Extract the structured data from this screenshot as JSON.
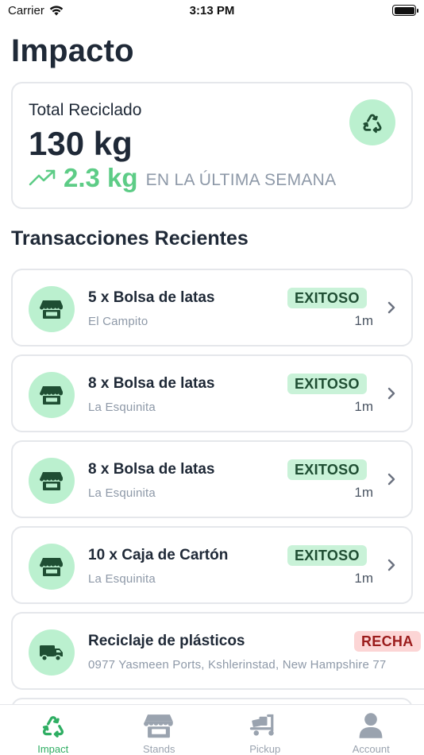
{
  "status_bar": {
    "carrier": "Carrier",
    "time": "3:13 PM"
  },
  "page": {
    "title": "Impacto"
  },
  "summary": {
    "label": "Total Reciclado",
    "value": "130 kg",
    "trend_value": "2.3 kg",
    "trend_caption": "EN LA ÚLTIMA SEMANA",
    "icon": "recycle-icon"
  },
  "recent": {
    "title": "Transacciones Recientes",
    "items": [
      {
        "title": "5 x Bolsa de latas",
        "subtitle": "El Campito",
        "status": "EXITOSO",
        "time": "1m",
        "icon": "store-icon"
      },
      {
        "title": "8 x Bolsa de latas",
        "subtitle": "La Esquinita",
        "status": "EXITOSO",
        "time": "1m",
        "icon": "store-icon"
      },
      {
        "title": "8 x Bolsa de latas",
        "subtitle": "La Esquinita",
        "status": "EXITOSO",
        "time": "1m",
        "icon": "store-icon"
      },
      {
        "title": "10 x Caja de Cartón",
        "subtitle": "La Esquinita",
        "status": "EXITOSO",
        "time": "1m",
        "icon": "store-icon"
      },
      {
        "title": "Reciclaje de plásticos",
        "subtitle": "0977 Yasmeen Ports, Kshlerinstad, New Hampshire 77",
        "status": "RECHA",
        "icon": "truck-icon"
      }
    ]
  },
  "tabs": [
    {
      "label": "Impact",
      "icon": "recycle-icon",
      "active": true
    },
    {
      "label": "Stands",
      "icon": "store-icon",
      "active": false
    },
    {
      "label": "Pickup",
      "icon": "truck-icon",
      "active": false
    },
    {
      "label": "Account",
      "icon": "person-icon",
      "active": false
    }
  ],
  "colors": {
    "accent_green": "#5dcc86",
    "badge_green_bg": "#bbf0cf",
    "success_bg": "#c9f2d8",
    "rejected_bg": "#fcd5d5",
    "rejected_text": "#9b1c1c"
  }
}
